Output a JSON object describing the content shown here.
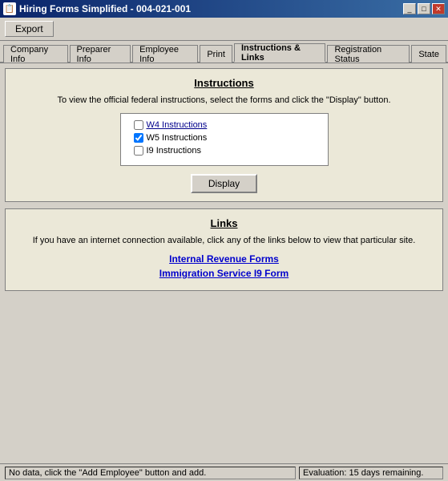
{
  "window": {
    "title": "Hiring Forms Simplified - 004-021-001",
    "icon": "📋"
  },
  "titleButtons": {
    "minimize": "_",
    "maximize": "□",
    "close": "✕"
  },
  "toolbar": {
    "export_label": "Export"
  },
  "tabs": [
    {
      "id": "company-info",
      "label": "Company Info",
      "active": false
    },
    {
      "id": "preparer-info",
      "label": "Preparer Info",
      "active": false
    },
    {
      "id": "employee-info",
      "label": "Employee Info",
      "active": false
    },
    {
      "id": "print",
      "label": "Print",
      "active": false
    },
    {
      "id": "instructions-links",
      "label": "Instructions & Links",
      "active": true
    },
    {
      "id": "registration-status",
      "label": "Registration Status",
      "active": false
    },
    {
      "id": "state",
      "label": "State",
      "active": false
    }
  ],
  "instructions_section": {
    "title": "Instructions",
    "description": "To view the official federal instructions, select the forms and click the \"Display\" button.",
    "checkboxes": [
      {
        "id": "w4",
        "label": "W4 Instructions",
        "checked": false,
        "isLink": true
      },
      {
        "id": "w5",
        "label": "W5 Instructions",
        "checked": true,
        "isLink": false
      },
      {
        "id": "i9",
        "label": "I9 Instructions",
        "checked": false,
        "isLink": false
      }
    ],
    "display_button": "Display"
  },
  "links_section": {
    "title": "Links",
    "description": "If you have an internet connection available, click any of the links below to view that particular site.",
    "links": [
      {
        "id": "irs-link",
        "label": "Internal Revenue Forms"
      },
      {
        "id": "i9-link",
        "label": "Immigration Service I9 Form"
      }
    ]
  },
  "status_bar": {
    "left": "No data, click the \"Add Employee\" button and add.",
    "right": "Evaluation: 15 days remaining."
  }
}
